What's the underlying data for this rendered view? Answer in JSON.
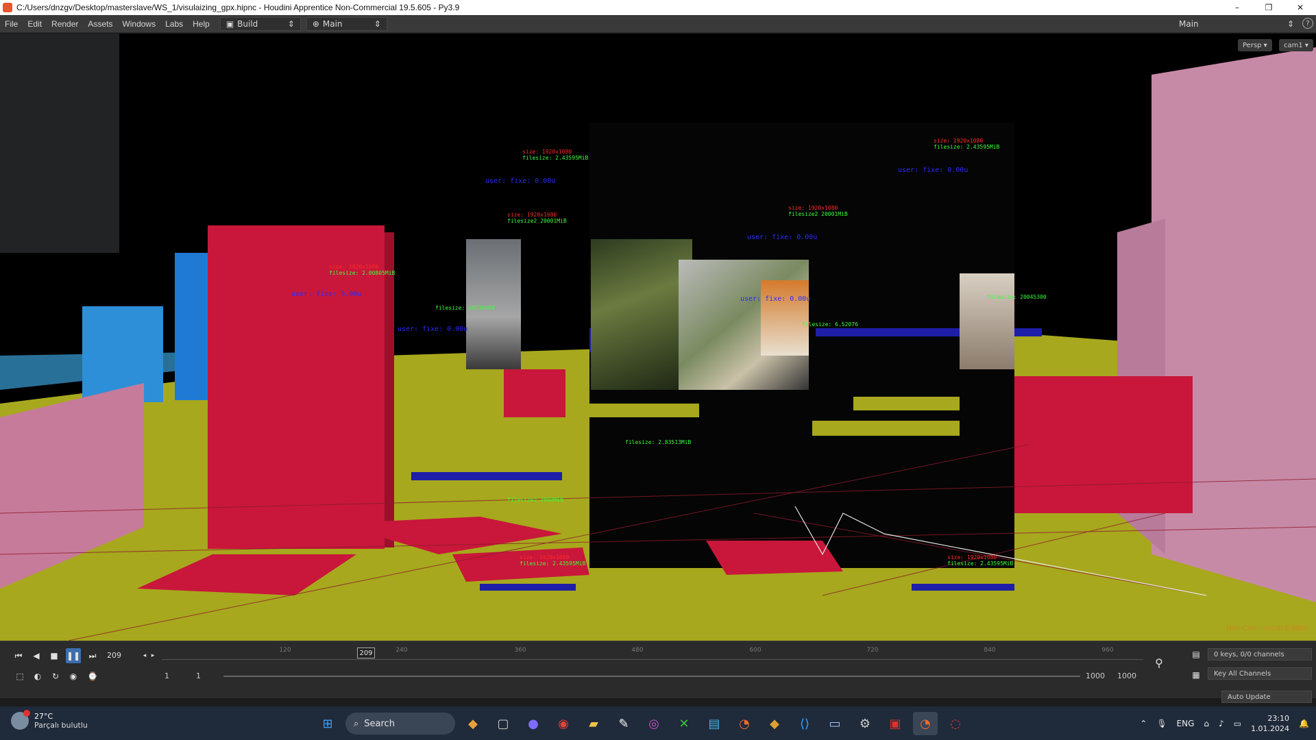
{
  "window": {
    "title": "C:/Users/dnzgv/Desktop/masterslave/WS_1/visulaizing_gpx.hipnc - Houdini Apprentice Non-Commercial 19.5.605 - Py3.9",
    "minimize": "–",
    "maximize": "❐",
    "close": "✕"
  },
  "menubar": {
    "items": [
      "File",
      "Edit",
      "Render",
      "Assets",
      "Windows",
      "Labs",
      "Help"
    ],
    "desktop": "Build",
    "pane": "Main",
    "right_pane": "Main",
    "help_glyph": "?"
  },
  "viewport": {
    "persp_btn": "Persp ▾",
    "cam_btn": "cam1 ▾",
    "watermark": "Non-Commercial Edition",
    "labels": [
      {
        "red": "size: 1920x1080",
        "green": "filesize: 2.43595MiB"
      },
      {
        "red": "size: 1920x1080",
        "green": "filesize: 2.43595MiB"
      },
      {
        "red": "size: 1920x1080",
        "green": "filesize2 20001MiB"
      },
      {
        "red": "size: 1920x1080",
        "green": "filesize2 20001MiB"
      },
      {
        "red": "size: 1920x1080",
        "green": "filesize: 2.00805MiB"
      },
      {
        "red": "",
        "green": "filesize: 20928008"
      },
      {
        "red": "",
        "green": "filesize: 6.52076"
      },
      {
        "red": "",
        "green": "filesize: 20045300"
      },
      {
        "red": "",
        "green": "filesize: 2.83513MiB"
      },
      {
        "red": "",
        "green": "filesize2 2000MiB"
      },
      {
        "red": "size: 1920x1080",
        "green": "filesize: 2.43595MiB"
      },
      {
        "red": "size: 1920x1080",
        "green": "filesize: 2.43595MiB"
      }
    ],
    "blue_labels": [
      "user: fixe: 0.00u",
      "user: fixe: 0.00u",
      "user: fixe: 0.00u",
      "user: fixe: 0.00u",
      "user: fixe: 0.00u",
      "user: fixe: 0.00u"
    ]
  },
  "playbar": {
    "frame": "209",
    "current_frame_marker": "209",
    "ticks": [
      "120",
      "240",
      "360",
      "480",
      "600",
      "720",
      "840",
      "960"
    ],
    "range_start": "1",
    "range_start2": "1",
    "range_end": "1000",
    "range_end2": "1000",
    "keys_info": "0 keys, 0/0 channels",
    "key_all": "Key All Channels",
    "auto_update": "Auto Update"
  },
  "taskbar": {
    "temp": "27°C",
    "weather": "Parçalı bulutlu",
    "search": "Search",
    "lang": "ENG",
    "time": "23:10",
    "date": "1.01.2024"
  },
  "colors": {
    "accent": "#3b6fb0",
    "red_box": "#c8173a",
    "yellow_ground": "#a7a81d",
    "blue_box": "#1f7ad6"
  }
}
